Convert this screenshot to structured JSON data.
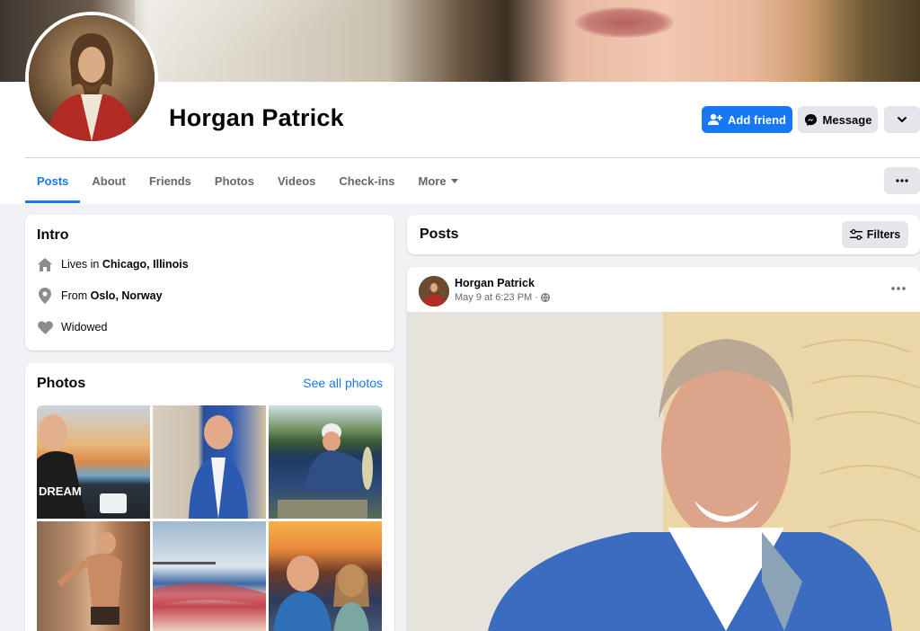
{
  "profile": {
    "name": "Horgan Patrick"
  },
  "actions": {
    "add_friend": "Add friend",
    "message": "Message"
  },
  "tabs": [
    {
      "label": "Posts",
      "active": true
    },
    {
      "label": "About"
    },
    {
      "label": "Friends"
    },
    {
      "label": "Photos"
    },
    {
      "label": "Videos"
    },
    {
      "label": "Check-ins"
    },
    {
      "label": "More"
    }
  ],
  "intro": {
    "title": "Intro",
    "lives_prefix": "Lives in",
    "lives_place": "Chicago, Illinois",
    "from_prefix": "From",
    "from_place": "Oslo, Norway",
    "status": "Widowed"
  },
  "photos": {
    "title": "Photos",
    "see_all": "See all photos"
  },
  "posts": {
    "title": "Posts",
    "filters": "Filters"
  },
  "post": {
    "author": "Horgan Patrick",
    "time": "May 9 at 6:23 PM ·"
  },
  "colors": {
    "accent": "#1877f2",
    "background": "#f0f2f5",
    "secondary_button": "#e4e6eb",
    "muted_text": "#65676b"
  },
  "icons": [
    "add-friend-icon",
    "messenger-icon",
    "chevron-down-icon",
    "more-dots-icon",
    "home-icon",
    "location-pin-icon",
    "heart-icon",
    "filters-icon",
    "globe-icon",
    "caret-down-icon"
  ]
}
